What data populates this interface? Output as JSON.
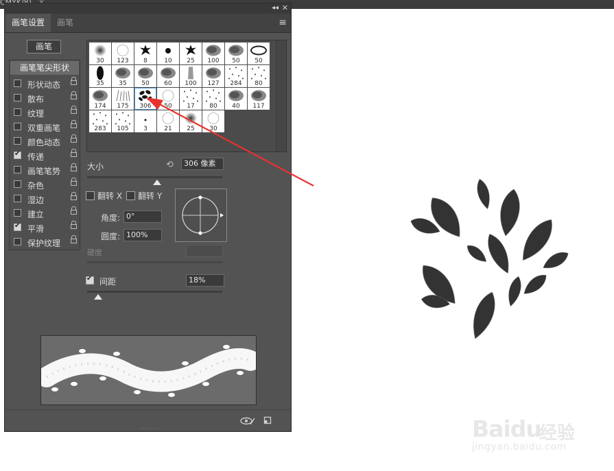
{
  "window": {
    "doc_tab_title": "CMYK/8)",
    "doc_tab_close": "×"
  },
  "panel": {
    "collapse": "◂◂",
    "close": "✕",
    "tabs": [
      {
        "label": "画笔设置",
        "active": true
      },
      {
        "label": "画笔",
        "active": false
      }
    ],
    "menu": "≡",
    "brush_button": "画笔",
    "options_header": "画笔笔尖形状",
    "options": [
      {
        "label": "形状动态",
        "checked": false
      },
      {
        "label": "散布",
        "checked": false
      },
      {
        "label": "纹理",
        "checked": false
      },
      {
        "label": "双重画笔",
        "checked": false
      },
      {
        "label": "颜色动态",
        "checked": false
      },
      {
        "label": "传递",
        "checked": true
      },
      {
        "label": "画笔笔势",
        "checked": false
      },
      {
        "label": "杂色",
        "checked": false
      },
      {
        "label": "湿边",
        "checked": false
      },
      {
        "label": "建立",
        "checked": false
      },
      {
        "label": "平滑",
        "checked": true
      },
      {
        "label": "保护纹理",
        "checked": false
      }
    ],
    "brush_tips": [
      {
        "size": "30",
        "shape": "soft"
      },
      {
        "size": "123",
        "shape": "hard"
      },
      {
        "size": "8",
        "shape": "splat"
      },
      {
        "size": "10",
        "shape": "dot"
      },
      {
        "size": "25",
        "shape": "splat"
      },
      {
        "size": "100",
        "shape": "grain"
      },
      {
        "size": "50",
        "shape": "grain"
      },
      {
        "size": "50",
        "shape": "oval"
      },
      {
        "size": "35",
        "shape": "oval-tall"
      },
      {
        "size": "35",
        "shape": "grain"
      },
      {
        "size": "50",
        "shape": "grain"
      },
      {
        "size": "60",
        "shape": "grain"
      },
      {
        "size": "100",
        "shape": "stroke"
      },
      {
        "size": "127",
        "shape": "grain"
      },
      {
        "size": "284",
        "shape": "scatter"
      },
      {
        "size": "80",
        "shape": "scatter"
      },
      {
        "size": "174",
        "shape": "grain"
      },
      {
        "size": "175",
        "shape": "grass"
      },
      {
        "size": "306",
        "shape": "leaves",
        "selected": true
      },
      {
        "size": "50",
        "shape": "hard"
      },
      {
        "size": "17",
        "shape": "scatter"
      },
      {
        "size": "80",
        "shape": "scatter"
      },
      {
        "size": "40",
        "shape": "grain"
      },
      {
        "size": "117",
        "shape": "grain"
      },
      {
        "size": "283",
        "shape": "scatter"
      },
      {
        "size": "105",
        "shape": "scatter"
      },
      {
        "size": "3",
        "shape": "tiny"
      },
      {
        "size": "21",
        "shape": "hard"
      },
      {
        "size": "25",
        "shape": "soft"
      },
      {
        "size": "30",
        "shape": "hard"
      }
    ],
    "size_label": "大小",
    "size_value": "306 像素",
    "size_slider": 0.52,
    "flip_x": "翻转 X",
    "flip_y": "翻转 Y",
    "angle_label": "角度:",
    "angle_value": "0°",
    "roundness_label": "圆度:",
    "roundness_value": "100%",
    "hardness_label": "硬度",
    "spacing_label": "间距",
    "spacing_value": "18%",
    "spacing_checked": true,
    "spacing_slider": 0.08
  },
  "canvas": {
    "content": "leaf-brush-stamp"
  },
  "watermark": {
    "logo": "Baidu",
    "cn": "经验",
    "url": "jingyan.baidu.com"
  },
  "colors": {
    "panel_bg": "#535353",
    "panel_dark": "#393939",
    "arrow": "#e8322f",
    "leaf": "#333333",
    "selection": "#4e9ad6"
  }
}
